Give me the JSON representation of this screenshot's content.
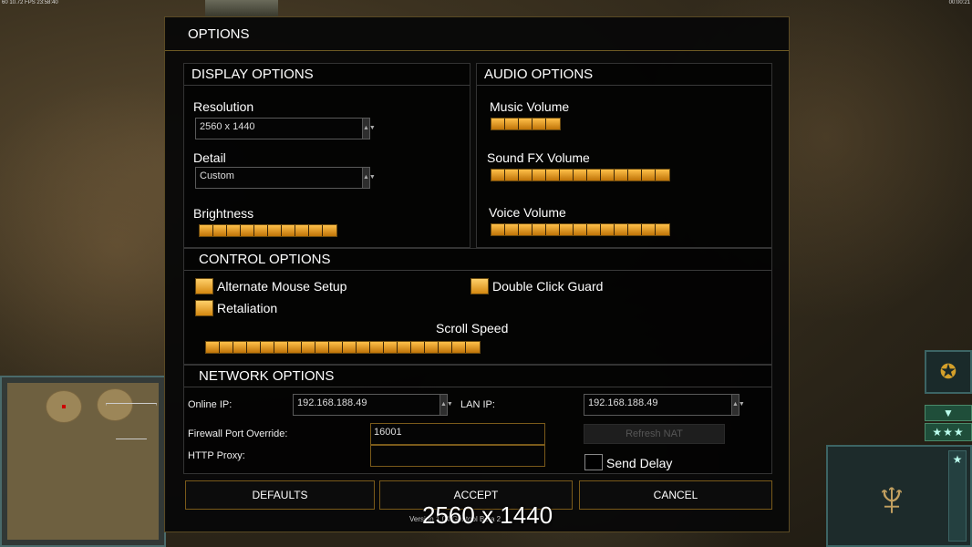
{
  "hud": {
    "top_left": "60 10.72 FPS 23:58:40",
    "top_right": "00:00:21"
  },
  "dialog": {
    "title": "OPTIONS",
    "display": {
      "header": "DISPLAY OPTIONS",
      "resolution_label": "Resolution",
      "resolution_value": "2560 x 1440",
      "detail_label": "Detail",
      "detail_value": "Custom",
      "brightness_label": "Brightness",
      "brightness_level": 10
    },
    "audio": {
      "header": "AUDIO OPTIONS",
      "music_label": "Music Volume",
      "music_level": 5,
      "sfx_label": "Sound FX Volume",
      "sfx_level": 13,
      "voice_label": "Voice Volume",
      "voice_level": 13
    },
    "control": {
      "header": "CONTROL OPTIONS",
      "alt_mouse_label": "Alternate Mouse Setup",
      "alt_mouse_checked": true,
      "double_click_label": "Double Click Guard",
      "double_click_checked": true,
      "retaliation_label": "Retaliation",
      "retaliation_checked": true,
      "scroll_speed_label": "Scroll Speed",
      "scroll_speed_level": 20
    },
    "network": {
      "header": "NETWORK OPTIONS",
      "online_ip_label": "Online IP:",
      "online_ip_value": "192.168.188.49",
      "lan_ip_label": "LAN IP:",
      "lan_ip_value": "192.168.188.49",
      "firewall_label": "Firewall Port Override:",
      "firewall_value": "16001",
      "proxy_label": "HTTP Proxy:",
      "proxy_value": "",
      "refresh_nat_label": "Refresh NAT",
      "send_delay_label": "Send Delay",
      "send_delay_checked": false
    },
    "buttons": {
      "defaults": "DEFAULTS",
      "accept": "ACCEPT",
      "cancel": "CANCEL"
    },
    "version_text": "Version 1.04 Gentool Beta 2",
    "overlay_resolution": "2560 x 1440"
  },
  "icons": {
    "rank": "rank-eagle-icon",
    "arrow": "chevron-down-icon",
    "stars": "three-stars-icon",
    "emblem": "faction-emblem-icon"
  },
  "colors": {
    "slider_fill": "#ffc04a",
    "accent_border": "#7a5a1a",
    "hud_teal": "#3c6464"
  }
}
